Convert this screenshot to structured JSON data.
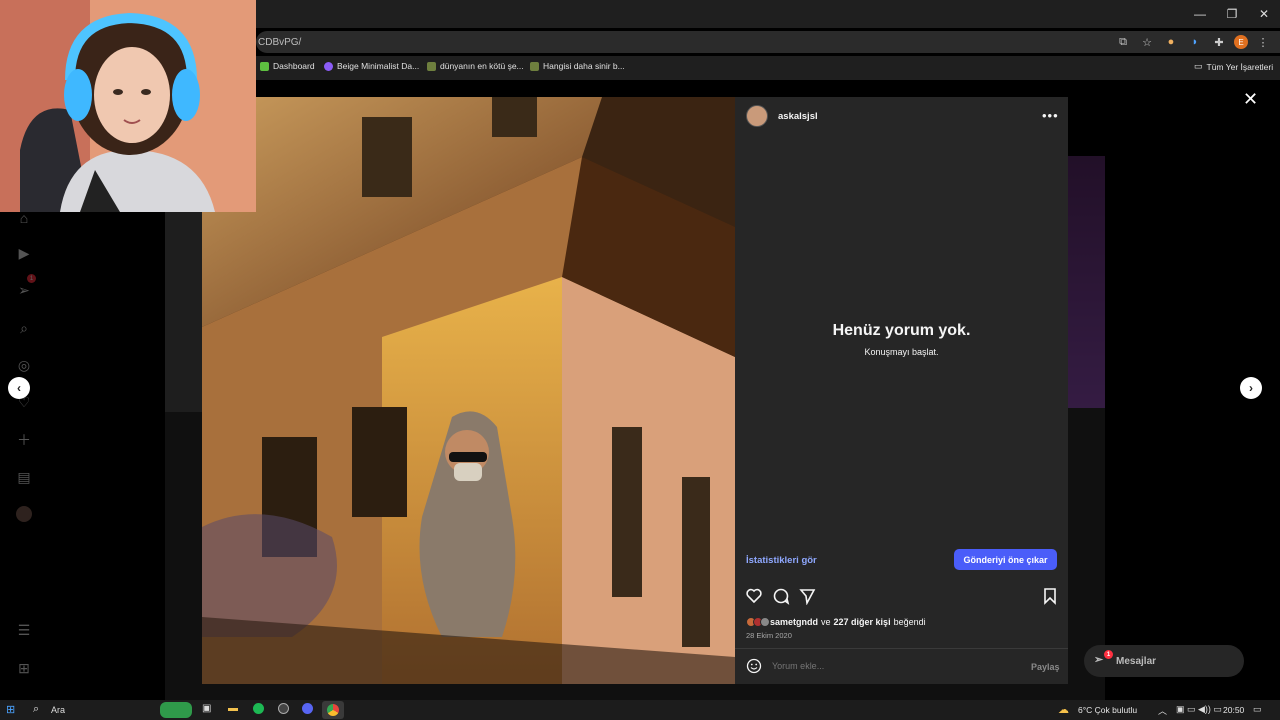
{
  "browser": {
    "url_fragment": "CDBvPG/",
    "bookmarks": [
      {
        "label": "Dashboard",
        "color": "#5ec040"
      },
      {
        "label": "Beige Minimalist Da...",
        "color": "#8b5cf6"
      },
      {
        "label": "dünyanın en kötü şe...",
        "color": "#6e7f3e"
      },
      {
        "label": "Hangisi daha sinir b...",
        "color": "#6e7f3e"
      }
    ],
    "all_bookmarks": "Tüm Yer İşaretleri",
    "profile_initial": "E"
  },
  "post": {
    "username": "askalsjsl",
    "no_comments_title": "Henüz yorum yok.",
    "no_comments_sub": "Konuşmayı başlat.",
    "stats_link": "İstatistikleri gör",
    "promote_button": "Gönderiyi öne çıkar",
    "liked_by_user": "sametgndd",
    "liked_by_connector": "ve",
    "liked_by_others": "227 diğer kişi",
    "liked_suffix": "beğendi",
    "date": "28 Ekim 2020",
    "comment_placeholder": "Yorum ekle...",
    "share_button": "Paylaş"
  },
  "sidebar": {
    "notification_count": "1"
  },
  "messages": {
    "label": "Mesajlar",
    "count": "1"
  },
  "taskbar": {
    "search_label": "Ara",
    "weather": "6°C  Çok bulutlu",
    "time": "20:50"
  }
}
